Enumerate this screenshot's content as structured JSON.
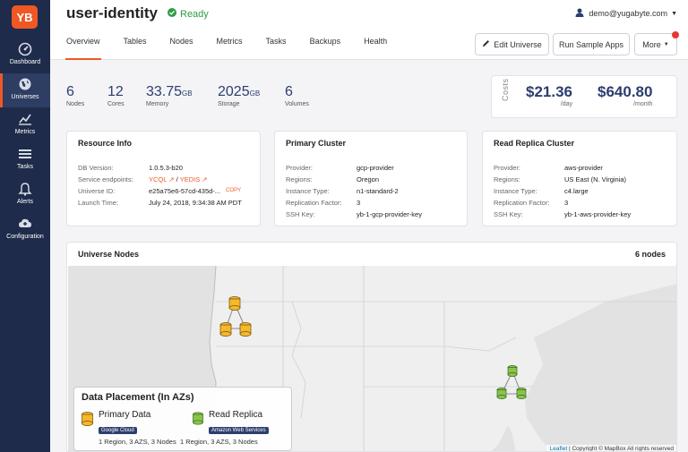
{
  "sidebar": {
    "logo": "YB",
    "items": [
      {
        "label": "Dashboard",
        "icon": "dashboard-icon"
      },
      {
        "label": "Universes",
        "icon": "globe-icon"
      },
      {
        "label": "Metrics",
        "icon": "metrics-chart-icon"
      },
      {
        "label": "Tasks",
        "icon": "tasks-list-icon"
      },
      {
        "label": "Alerts",
        "icon": "bell-icon"
      },
      {
        "label": "Configuration",
        "icon": "cloud-config-icon"
      }
    ],
    "active_index": 1
  },
  "header": {
    "title": "user-identity",
    "status": "Ready",
    "user_email": "demo@yugabyte.com",
    "tabs": [
      "Overview",
      "Tables",
      "Nodes",
      "Metrics",
      "Tasks",
      "Backups",
      "Health"
    ],
    "active_tab": "Overview",
    "buttons": {
      "edit": "Edit Universe",
      "sample": "Run Sample Apps",
      "more": "More"
    }
  },
  "stats": [
    {
      "value": "6",
      "unit": "",
      "label": "Nodes"
    },
    {
      "value": "12",
      "unit": "",
      "label": "Cores"
    },
    {
      "value": "33.75",
      "unit": "GB",
      "label": "Memory"
    },
    {
      "value": "2025",
      "unit": "GB",
      "label": "Storage"
    },
    {
      "value": "6",
      "unit": "",
      "label": "Volumes"
    }
  ],
  "costs": {
    "label": "Costs",
    "daily": {
      "amount": "$21.36",
      "period": "/day"
    },
    "monthly": {
      "amount": "$640.80",
      "period": "/month"
    }
  },
  "resource_info": {
    "title": "Resource Info",
    "rows": [
      {
        "key": "DB Version:",
        "value": "1.0.5.3-b20"
      },
      {
        "key": "Service endpoints:",
        "value": ""
      },
      {
        "key": "Universe ID:",
        "value": "e25a75e6-57cd-435d-..."
      },
      {
        "key": "Launch Time:",
        "value": "July 24, 2018, 9:34:38 AM PDT"
      }
    ],
    "endpoint_ycql": "YCQL",
    "endpoint_sep": "/",
    "endpoint_yedis": "YEDIS",
    "copy_label": "COPY"
  },
  "primary_cluster": {
    "title": "Primary Cluster",
    "rows": [
      {
        "key": "Provider:",
        "value": "gcp-provider"
      },
      {
        "key": "Regions:",
        "value": "Oregon"
      },
      {
        "key": "Instance Type:",
        "value": "n1-standard-2"
      },
      {
        "key": "Replication Factor:",
        "value": "3"
      },
      {
        "key": "SSH Key:",
        "value": "yb-1-gcp-provider-key"
      }
    ]
  },
  "read_replica_cluster": {
    "title": "Read Replica Cluster",
    "rows": [
      {
        "key": "Provider:",
        "value": "aws-provider"
      },
      {
        "key": "Regions:",
        "value": "US East (N. Virginia)"
      },
      {
        "key": "Instance Type:",
        "value": "c4.large"
      },
      {
        "key": "Replication Factor:",
        "value": "3"
      },
      {
        "key": "SSH Key:",
        "value": "yb-1-aws-provider-key"
      }
    ]
  },
  "universe_nodes": {
    "title": "Universe Nodes",
    "count": "6 nodes",
    "placement": {
      "title": "Data Placement (In AZs)",
      "primary": {
        "name": "Primary Data",
        "badge": "Google Cloud",
        "summary": "1 Region, 3 AZS, 3 Nodes"
      },
      "replica": {
        "name": "Read Replica",
        "badge": "Amazon Web Services",
        "summary": "1 Region, 3 AZS, 3 Nodes"
      }
    },
    "attribution_link": "Leaflet",
    "attribution_text": " | Copyright © MapBox All rights reserved"
  },
  "colors": {
    "accent": "#ef5824",
    "navy": "#1e2b4a",
    "ready": "#2e9c43",
    "primary_node": "#f5b82e",
    "replica_node": "#8bc34a"
  }
}
